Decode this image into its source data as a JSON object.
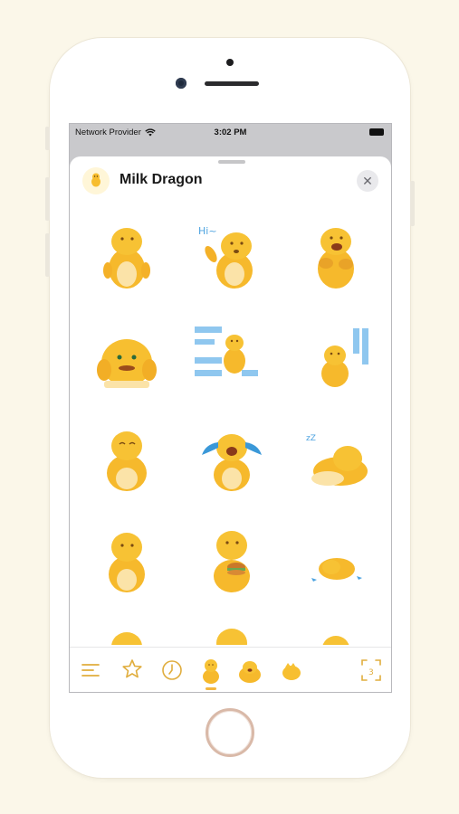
{
  "status_bar": {
    "carrier": "Network Provider",
    "time": "3:02 PM"
  },
  "sheet": {
    "title": "Milk Dragon",
    "close_symbol": "✕"
  },
  "stickers": [
    {
      "name": "sticker-dragon-standing"
    },
    {
      "name": "sticker-dragon-waving-hi"
    },
    {
      "name": "sticker-dragon-eating"
    },
    {
      "name": "sticker-dragon-squishing-cheeks"
    },
    {
      "name": "sticker-dragon-chinese-text-left"
    },
    {
      "name": "sticker-dragon-chinese-text-right"
    },
    {
      "name": "sticker-dragon-smiling"
    },
    {
      "name": "sticker-dragon-crying"
    },
    {
      "name": "sticker-dragon-lying-sleeping"
    },
    {
      "name": "sticker-dragon-sitting"
    },
    {
      "name": "sticker-dragon-eating-burger"
    },
    {
      "name": "sticker-dragon-flat-on-floor"
    }
  ],
  "toolbar": {
    "items": [
      "menu-icon",
      "star-icon",
      "recent-clock-icon",
      "pack-dragon-1",
      "pack-dragon-2",
      "pack-dragon-3",
      "fullscreen-icon"
    ],
    "expand_badge": "3"
  },
  "colors": {
    "background": "#fbf7e9",
    "accent": "#e9b53e",
    "dragon": "#f7bd2e"
  }
}
